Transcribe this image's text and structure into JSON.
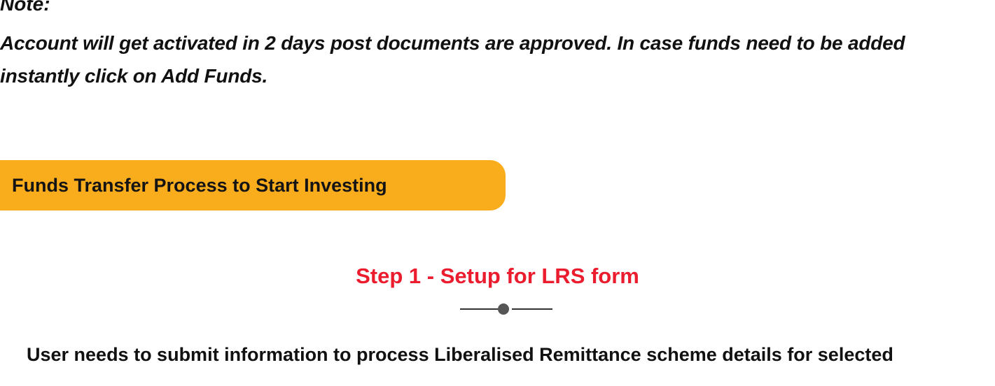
{
  "note": {
    "heading": "Note:",
    "lines": [
      "Account will get activated in 2 days post documents are approved. In case funds need to be added",
      "instantly click on Add Funds."
    ]
  },
  "section": {
    "title": "Funds Transfer Process to Start Investing",
    "banner_color": "#f9ac1c"
  },
  "step": {
    "title": "Step 1 - Setup for LRS form",
    "title_color": "#ea1c2e",
    "description": "User needs to submit information to process Liberalised Remittance scheme details for selected"
  }
}
